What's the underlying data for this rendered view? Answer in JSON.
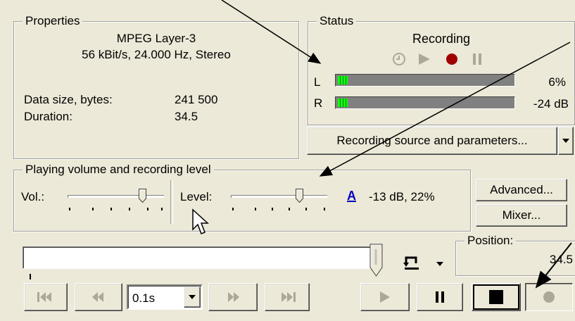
{
  "properties": {
    "title": "Properties",
    "format": "MPEG Layer-3",
    "params": "56 kBit/s, 24.000 Hz, Stereo",
    "data_size_label": "Data size, bytes:",
    "data_size_value": "241 500",
    "duration_label": "Duration:",
    "duration_value": "34.5"
  },
  "status": {
    "title": "Status",
    "state": "Recording",
    "left_channel": "L",
    "right_channel": "R",
    "left_percent": "6%",
    "right_db": "-24 dB",
    "left_level": 0.06,
    "right_level": 0.06
  },
  "recording_source_button": "Recording source and parameters...",
  "levels": {
    "title": "Playing volume and recording level",
    "vol_label": "Vol.:",
    "level_label": "Level:",
    "level_value": "-13 dB, 22%",
    "font_glyph": "A",
    "vol_position": 0.78,
    "level_position": 0.72
  },
  "advanced_button": "Advanced...",
  "mixer_button": "Mixer...",
  "position": {
    "title": "Position:",
    "value": "34.5"
  },
  "step_value": "0.1s",
  "colors": {
    "face": "#ece9d8",
    "record_red": "#a00000",
    "meter_green": "#10ff10",
    "font_icon_blue": "#0000c0"
  }
}
